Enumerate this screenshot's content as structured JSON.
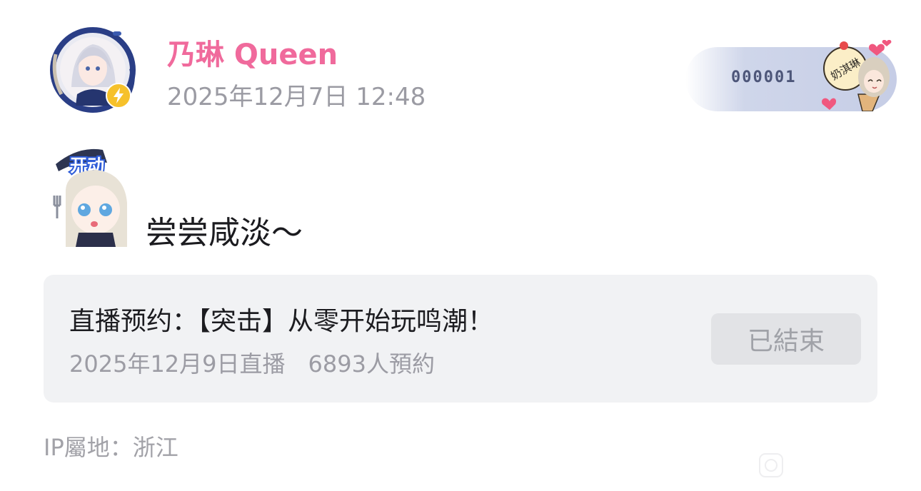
{
  "post": {
    "author_name": "乃琳 Queen",
    "timestamp": "2025年12月7日 12:48",
    "verified_icon": "lightning-icon",
    "fan_badge": {
      "number": "000001",
      "text": "奶淇琳"
    },
    "sticker": {
      "text": "开动"
    },
    "text": "尝尝咸淡～"
  },
  "live_card": {
    "title": "直播预约：【突击】从零开始玩鸣潮！",
    "subtitle": "2025年12月9日直播　6893人預約",
    "button_label": "已結束"
  },
  "footer": {
    "ip_location": "IP屬地：浙江"
  },
  "colors": {
    "author_name": "#f06a9c",
    "verified_badge": "#f6c12b",
    "fan_badge_bg": "#c6cde6",
    "card_bg": "#f1f2f4"
  }
}
